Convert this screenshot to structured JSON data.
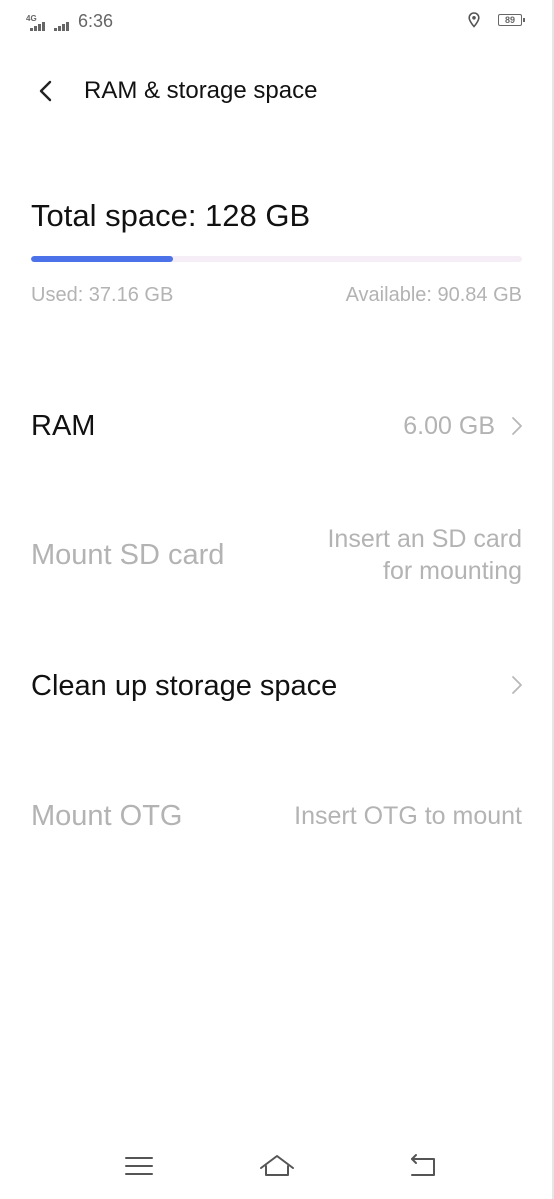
{
  "status_bar": {
    "network_type": "4G",
    "time": "6:36",
    "battery_level": "89"
  },
  "header": {
    "title": "RAM & storage space"
  },
  "storage": {
    "total_label": "Total space: 128 GB",
    "used_label": "Used: 37.16 GB",
    "available_label": "Available: 90.84 GB",
    "used_fraction": 0.29,
    "bar_color": "#4b72e8"
  },
  "rows": {
    "ram": {
      "label": "RAM",
      "value": "6.00 GB"
    },
    "sd_card": {
      "label": "Mount SD card",
      "value_line1": "Insert an SD card",
      "value_line2": "for mounting"
    },
    "cleanup": {
      "label": "Clean up storage space"
    },
    "otg": {
      "label": "Mount OTG",
      "value": "Insert OTG to mount"
    }
  },
  "icons": {
    "back": "back-arrow-icon",
    "chevron": "chevron-right-icon",
    "location": "location-pin-icon",
    "menu": "menu-icon",
    "home": "home-icon",
    "back_nav": "back-nav-icon"
  }
}
